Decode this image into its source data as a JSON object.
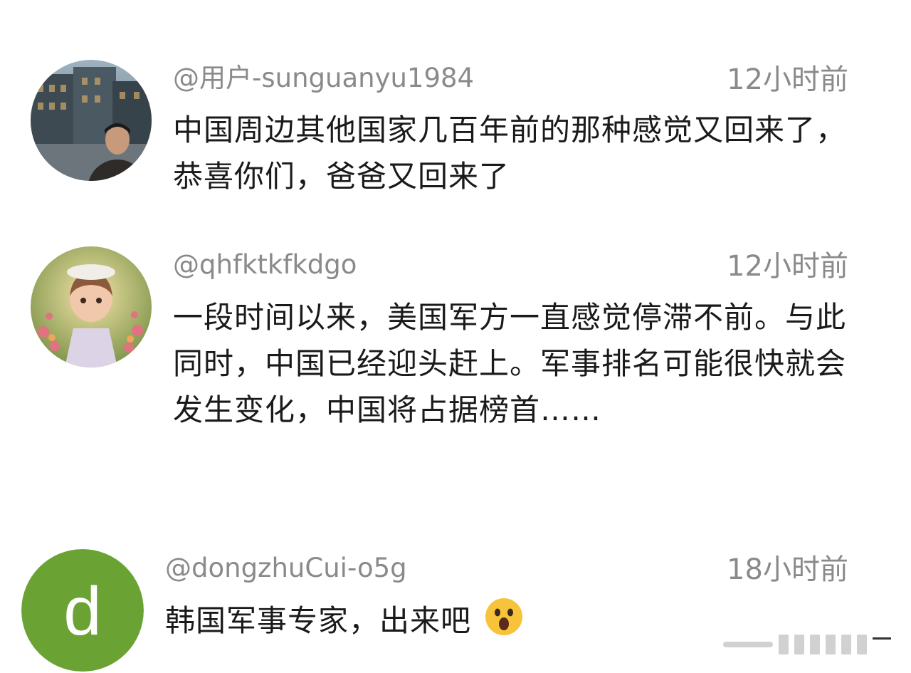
{
  "comments": [
    {
      "username": "@用户-sunguanyu1984",
      "time": "12小时前",
      "text": "中国周边其他国家几百年前的那种感觉又回来了，恭喜你们，爸爸又回来了",
      "avatar": "photo-man-city-street"
    },
    {
      "username": "@qhfktkfkdgo",
      "time": "12小时前",
      "text": "一段时间以来，美国军方一直感觉停滞不前。与此同时，中国已经迎头赶上。军事排名可能很快就会发生变化，中国将占据榜首……",
      "avatar": "illustration-girl-flowers"
    },
    {
      "username": "@dongzhuCui-o5g",
      "time": "18小时前",
      "text": "韩国军事专家，出来吧",
      "avatar_letter": "d",
      "avatar_color": "#6aa334",
      "emoji": "astonished-face-emoji"
    }
  ]
}
